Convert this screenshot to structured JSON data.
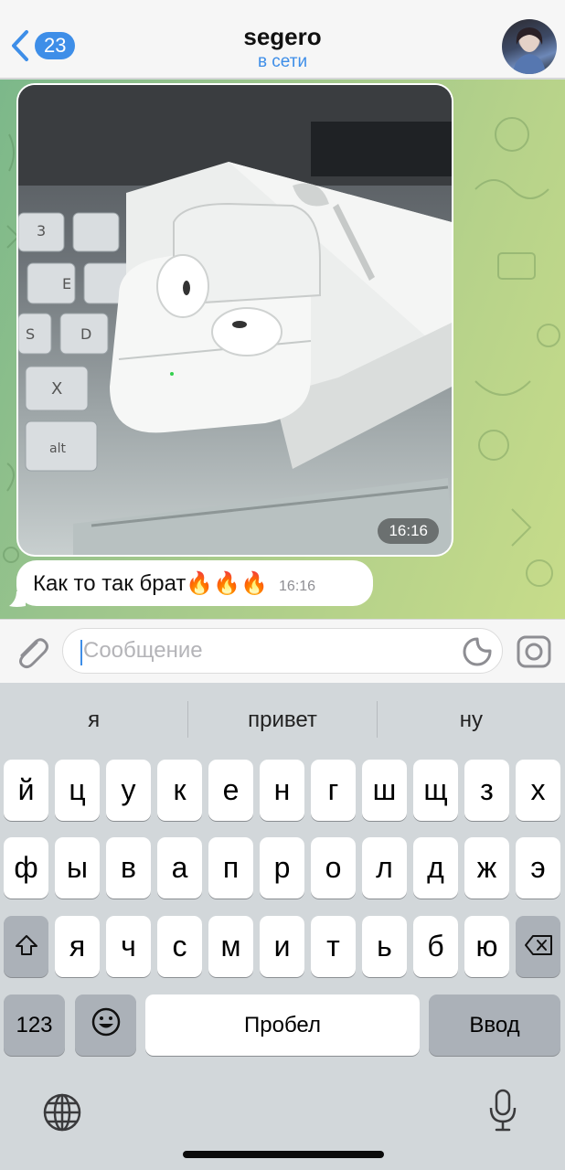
{
  "header": {
    "back_badge": "23",
    "title": "segero",
    "status": "в сети"
  },
  "messages": {
    "photo": {
      "time": "16:16"
    },
    "text": {
      "body": "Как то так брат🔥🔥🔥",
      "time": "16:16"
    }
  },
  "composer": {
    "placeholder": "Сообщение",
    "value": ""
  },
  "keyboard": {
    "suggestions": [
      "я",
      "привет",
      "ну"
    ],
    "row1": [
      "й",
      "ц",
      "у",
      "к",
      "е",
      "н",
      "г",
      "ш",
      "щ",
      "з",
      "х"
    ],
    "row2": [
      "ф",
      "ы",
      "в",
      "а",
      "п",
      "р",
      "о",
      "л",
      "д",
      "ж",
      "э"
    ],
    "row3": [
      "я",
      "ч",
      "с",
      "м",
      "и",
      "т",
      "ь",
      "б",
      "ю"
    ],
    "numbers_label": "123",
    "space_label": "Пробел",
    "return_label": "Ввод"
  },
  "colors": {
    "accent": "#3e8ee8",
    "chat_bg_start": "#7cb88a",
    "chat_bg_end": "#c7dc8a",
    "keyboard_bg": "#d2d7da",
    "dark_key": "#abb1b8"
  },
  "icons": {
    "back": "chevron-left-icon",
    "attach": "paperclip-icon",
    "sticker": "sticker-icon",
    "camera": "camera-icon",
    "shift": "shift-icon",
    "delete": "backspace-icon",
    "emoji": "emoji-icon",
    "globe": "globe-icon",
    "mic": "microphone-icon"
  }
}
